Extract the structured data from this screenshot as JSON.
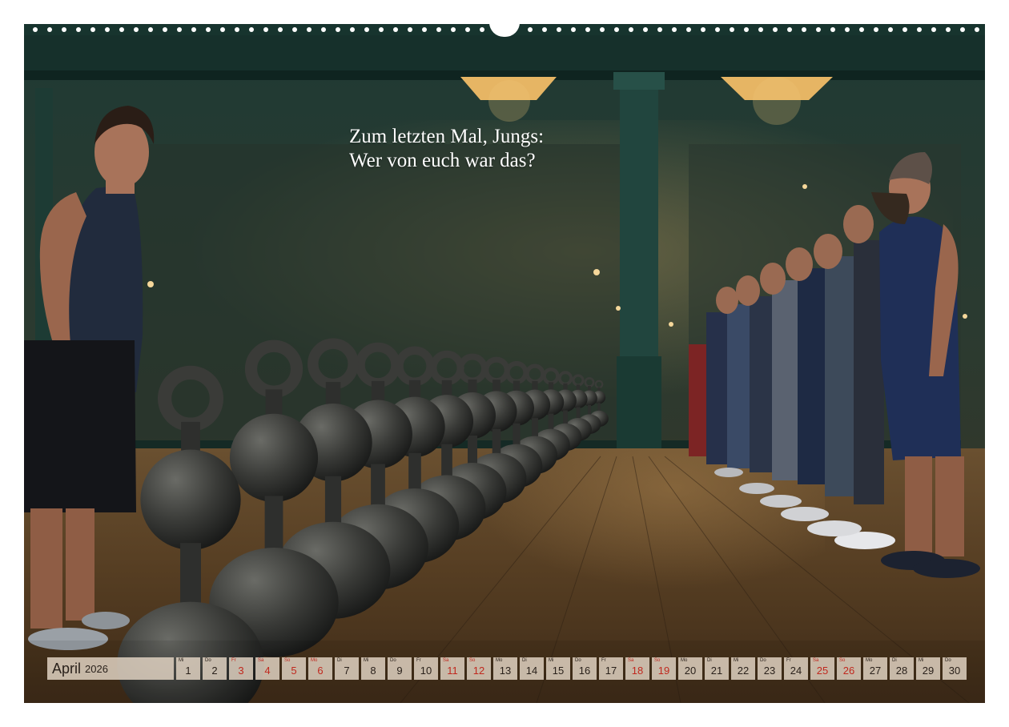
{
  "caption": {
    "line1": "Zum letzten Mal, Jungs:",
    "line2": "Wer von euch war das?"
  },
  "calendar": {
    "month": "April",
    "year": "2026",
    "days": [
      {
        "wd": "Mi",
        "day": "1",
        "weekend": false
      },
      {
        "wd": "Do",
        "day": "2",
        "weekend": false
      },
      {
        "wd": "Fr",
        "day": "3",
        "weekend": true
      },
      {
        "wd": "Sa",
        "day": "4",
        "weekend": true
      },
      {
        "wd": "So",
        "day": "5",
        "weekend": true
      },
      {
        "wd": "Mo",
        "day": "6",
        "weekend": true
      },
      {
        "wd": "Di",
        "day": "7",
        "weekend": false
      },
      {
        "wd": "Mi",
        "day": "8",
        "weekend": false
      },
      {
        "wd": "Do",
        "day": "9",
        "weekend": false
      },
      {
        "wd": "Fr",
        "day": "10",
        "weekend": false
      },
      {
        "wd": "Sa",
        "day": "11",
        "weekend": true
      },
      {
        "wd": "So",
        "day": "12",
        "weekend": true
      },
      {
        "wd": "Mo",
        "day": "13",
        "weekend": false
      },
      {
        "wd": "Di",
        "day": "14",
        "weekend": false
      },
      {
        "wd": "Mi",
        "day": "15",
        "weekend": false
      },
      {
        "wd": "Do",
        "day": "16",
        "weekend": false
      },
      {
        "wd": "Fr",
        "day": "17",
        "weekend": false
      },
      {
        "wd": "Sa",
        "day": "18",
        "weekend": true
      },
      {
        "wd": "So",
        "day": "19",
        "weekend": true
      },
      {
        "wd": "Mo",
        "day": "20",
        "weekend": false
      },
      {
        "wd": "Di",
        "day": "21",
        "weekend": false
      },
      {
        "wd": "Mi",
        "day": "22",
        "weekend": false
      },
      {
        "wd": "Do",
        "day": "23",
        "weekend": false
      },
      {
        "wd": "Fr",
        "day": "24",
        "weekend": false
      },
      {
        "wd": "Sa",
        "day": "25",
        "weekend": true
      },
      {
        "wd": "So",
        "day": "26",
        "weekend": true
      },
      {
        "wd": "Mo",
        "day": "27",
        "weekend": false
      },
      {
        "wd": "Di",
        "day": "28",
        "weekend": false
      },
      {
        "wd": "Mi",
        "day": "29",
        "weekend": false
      },
      {
        "wd": "Do",
        "day": "30",
        "weekend": false
      }
    ]
  },
  "colors": {
    "weekend": "#c0281e",
    "cell": "#ded0c0",
    "binding": "#17342e"
  }
}
